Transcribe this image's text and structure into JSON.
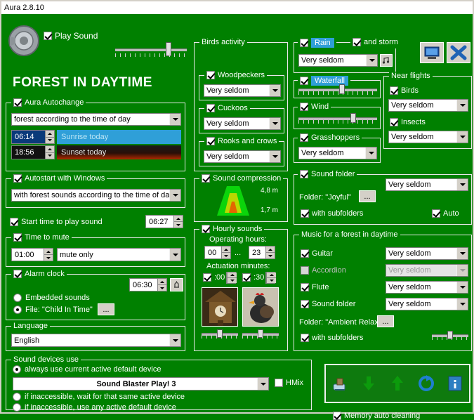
{
  "window": {
    "title": "Aura 2.8.10"
  },
  "header": {
    "play_sound_label": "Play Sound",
    "main_title": "FOREST IN DAYTIME",
    "volume_slider_value": 72
  },
  "toolbar_right": {
    "minimize_name": "minimize-button",
    "close_name": "close-button"
  },
  "autochange": {
    "group_label": "Aura Autochange",
    "checkbox_checked": true,
    "mode": "forest according to the time of day",
    "sunrise_time": "06:14",
    "sunrise_label": "Sunrise today",
    "sunset_time": "18:56",
    "sunset_label": "Sunset today"
  },
  "autostart": {
    "group_label": "",
    "checkbox_label": "Autostart with Windows",
    "checkbox_checked": true,
    "mode": "with forest sounds according to the time of da"
  },
  "start_time": {
    "label": "Start time to play sound",
    "checked": true,
    "value": "06:27"
  },
  "mute": {
    "group_label": "Time to mute",
    "checked": true,
    "duration": "01:00",
    "mode": "mute only"
  },
  "alarm": {
    "group_label": "Alarm clock",
    "checked": true,
    "time": "06:30",
    "embedded_label": "Embedded sounds",
    "embedded_selected": false,
    "file_label": "File: \"Child In Time\"",
    "file_selected": true,
    "browse_label": "..."
  },
  "language": {
    "group_label": "Language",
    "value": "English"
  },
  "sound_devices": {
    "group_label": "Sound devices use",
    "option_default": "always use current active default device",
    "option_default_selected": true,
    "device_name": "Sound Blaster Play! 3",
    "hmix_label": "HMix",
    "hmix_checked": false,
    "option_same": "if inaccessible, wait for that same active device",
    "option_same_selected": false,
    "option_any": "if inaccessible, use any active default device",
    "option_any_selected": false
  },
  "birds_activity": {
    "group_label": "Birds activity",
    "items": [
      {
        "name": "Woodpeckers",
        "checked": true,
        "frequency": "Very seldom"
      },
      {
        "name": "Cuckoos",
        "checked": true,
        "frequency": "Very seldom"
      },
      {
        "name": "Rooks and crows",
        "checked": true,
        "frequency": "Very seldom"
      }
    ]
  },
  "sound_compression": {
    "group_label": "Sound compression",
    "checked": true,
    "top_label": "4,8 m",
    "bottom_label": "1,7 m"
  },
  "hourly": {
    "group_label": "Hourly sounds",
    "checked": true,
    "operating_hours_label": "Operating hours:",
    "hour_from": "00",
    "dots": "...",
    "hour_to": "23",
    "actuation_label": "Actuation minutes:",
    "min_00_label": ":00",
    "min_00_checked": true,
    "min_30_label": ":30",
    "min_30_checked": true,
    "thumb_left_name": "cuckoo-clock-image",
    "thumb_right_name": "rooster-image"
  },
  "weather": {
    "rain_label": "Rain",
    "rain_checked": true,
    "rain_highlighted": true,
    "storm_label": "and storm",
    "storm_checked": true,
    "rain_frequency": "Very seldom",
    "waterfall_label": "Waterfall",
    "waterfall_checked": true,
    "waterfall_highlighted": true,
    "wind_label": "Wind",
    "wind_checked": true,
    "grasshoppers_label": "Grasshoppers",
    "grasshoppers_checked": true,
    "grasshoppers_frequency": "Very seldom"
  },
  "near_flights": {
    "group_label": "Near flights",
    "items": [
      {
        "name": "Birds",
        "checked": true,
        "frequency": "Very seldom"
      },
      {
        "name": "Insects",
        "checked": true,
        "frequency": "Very seldom"
      }
    ]
  },
  "sound_folder_top": {
    "group_label": "Sound folder",
    "checked": true,
    "frequency": "Very seldom",
    "folder_label": "Folder: \"Joyful\"",
    "browse_label": "...",
    "subfolders_label": "with subfolders",
    "subfolders_checked": true,
    "auto_label": "Auto",
    "auto_checked": true
  },
  "music": {
    "group_label": "Music for a forest in daytime",
    "items": [
      {
        "name": "Guitar",
        "checked": true,
        "frequency": "Very seldom",
        "enabled": true
      },
      {
        "name": "Accordion",
        "checked": false,
        "frequency": "Very seldom",
        "enabled": false
      },
      {
        "name": "Flute",
        "checked": true,
        "frequency": "Very seldom",
        "enabled": true
      },
      {
        "name": "Sound folder",
        "checked": true,
        "frequency": "Very seldom",
        "enabled": true
      }
    ],
    "folder_label": "Folder: \"Ambient Relax\"",
    "browse_label": "...",
    "subfolders_label": "with subfolders",
    "subfolders_checked": true
  },
  "bottom_toolbar": {
    "buttons": [
      "brush-icon",
      "download-icon",
      "open-folder-icon",
      "refresh-icon",
      "info-icon"
    ],
    "memory_label": "Memory auto cleaning",
    "memory_checked": true
  }
}
